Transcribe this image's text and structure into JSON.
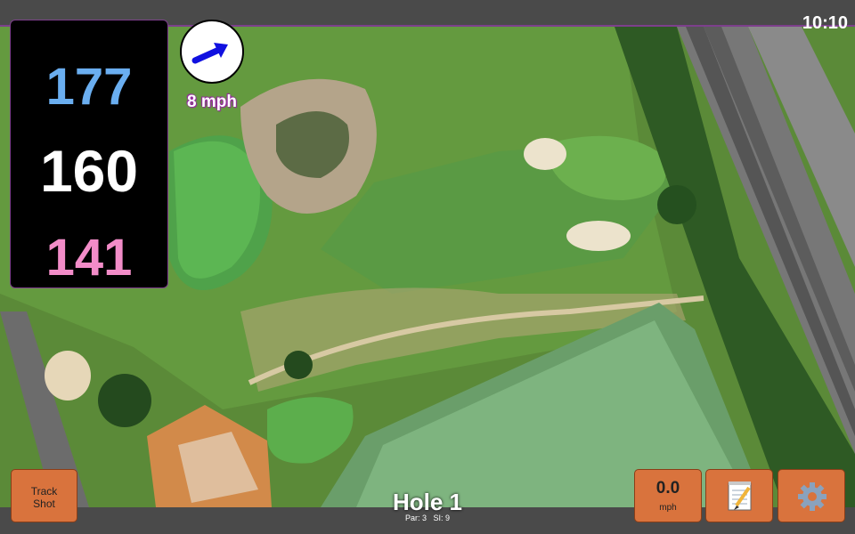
{
  "status_bar": {
    "time": "10:10"
  },
  "distances": {
    "back": "177",
    "middle": "160",
    "front": "141",
    "colors": {
      "back": "#6aaef0",
      "middle": "#ffffff",
      "front": "#f28cc8"
    }
  },
  "wind": {
    "speed_label": "8 mph",
    "icon": "wind-direction-arrow-icon",
    "arrow_color": "#1010e0"
  },
  "map": {
    "type": "satellite",
    "description_icons": [
      "sand-bunker",
      "green",
      "driving-range",
      "railway",
      "road"
    ]
  },
  "hole": {
    "title": "Hole 1",
    "info": "Par: 3   SI: 9"
  },
  "buttons": {
    "track_shot": "Track Shot",
    "speed_value": "0.0",
    "speed_unit": "mph",
    "notes_icon": "notepad-icon",
    "settings_icon": "gear-icon",
    "color": "#d9733d"
  }
}
